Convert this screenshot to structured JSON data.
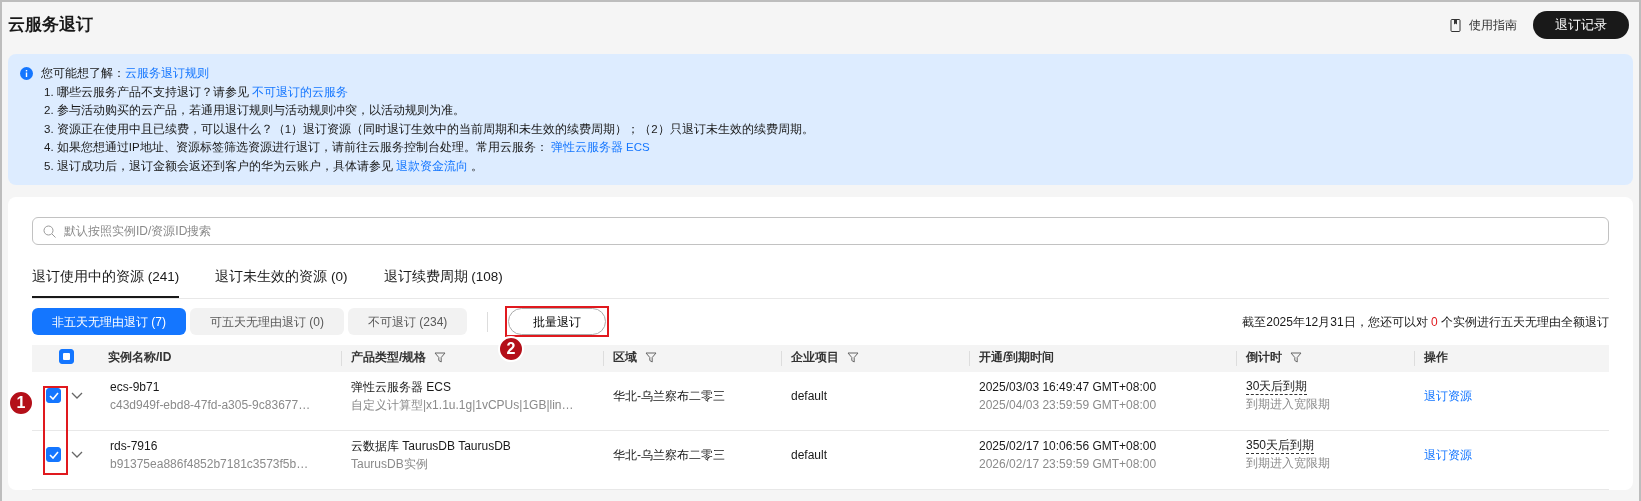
{
  "page": {
    "title": "云服务退订",
    "guide_link": "使用指南",
    "records_button": "退订记录"
  },
  "notice": {
    "intro": "您可能想了解：",
    "intro_link": "云服务退订规则",
    "items": [
      {
        "text": "1. 哪些云服务产品不支持退订？请参见 ",
        "link": "不可退订的云服务"
      },
      {
        "text": "2. 参与活动购买的云产品，若通用退订规则与活动规则冲突，以活动规则为准。"
      },
      {
        "text": "3. 资源正在使用中且已续费，可以退什么？（1）退订资源（同时退订生效中的当前周期和未生效的续费周期）；（2）只退订未生效的续费周期。"
      },
      {
        "text": "4. 如果您想通过IP地址、资源标签筛选资源进行退订，请前往云服务控制台处理。常用云服务： ",
        "link": "弹性云服务器 ECS"
      },
      {
        "text": "5. 退订成功后，退订金额会返还到客户的华为云账户，具体请参见 ",
        "link": "退款资金流向",
        "after": " 。"
      }
    ]
  },
  "search": {
    "placeholder": "默认按照实例ID/资源ID搜索"
  },
  "tabs": [
    {
      "label": "退订使用中的资源 (241)",
      "selected": true
    },
    {
      "label": "退订未生效的资源 (0)",
      "selected": false
    },
    {
      "label": "退订续费周期 (108)",
      "selected": false
    }
  ],
  "filters": [
    {
      "label": "非五天无理由退订 (7)",
      "selected": true
    },
    {
      "label": "可五天无理由退订 (0)",
      "selected": false
    },
    {
      "label": "不可退订 (234)",
      "selected": false
    }
  ],
  "batch_button": "批量退订",
  "quota": {
    "before": "截至2025年12月31日，您还可以对 ",
    "count": "0",
    "after": " 个实例进行五天无理由全额退订"
  },
  "table": {
    "select_all_partial": true,
    "columns": [
      {
        "label": "实例名称/ID",
        "filter": false
      },
      {
        "label": "产品类型/规格",
        "filter": true
      },
      {
        "label": "区域",
        "filter": true
      },
      {
        "label": "企业项目",
        "filter": true
      },
      {
        "label": "开通/到期时间",
        "filter": false
      },
      {
        "label": "倒计时",
        "filter": true
      },
      {
        "label": "操作",
        "filter": false
      }
    ],
    "rows": [
      {
        "checked": true,
        "name": "ecs-9b71",
        "id": "c43d949f-ebd8-47fd-a305-9c83677…",
        "product": "弹性云服务器 ECS",
        "spec": "自定义计算型|x1.1u.1g|1vCPUs|1GB|lin…",
        "region": "华北-乌兰察布二零三",
        "project": "default",
        "start": "2025/03/03 16:49:47 GMT+08:00",
        "end": "2025/04/03 23:59:59 GMT+08:00",
        "countdown": "30天后到期",
        "countdown_note": "到期进入宽限期",
        "action": "退订资源"
      },
      {
        "checked": true,
        "name": "rds-7916",
        "id": "b91375ea886f4852b7181c3573f5b…",
        "product": "云数据库 TaurusDB TaurusDB",
        "spec": "TaurusDB实例",
        "region": "华北-乌兰察布二零三",
        "project": "default",
        "start": "2025/02/17 10:06:56 GMT+08:00",
        "end": "2026/02/17 23:59:59 GMT+08:00",
        "countdown": "350天后到期",
        "countdown_note": "到期进入宽限期",
        "action": "退订资源"
      }
    ]
  },
  "callouts": [
    {
      "number": "1"
    },
    {
      "number": "2"
    }
  ]
}
